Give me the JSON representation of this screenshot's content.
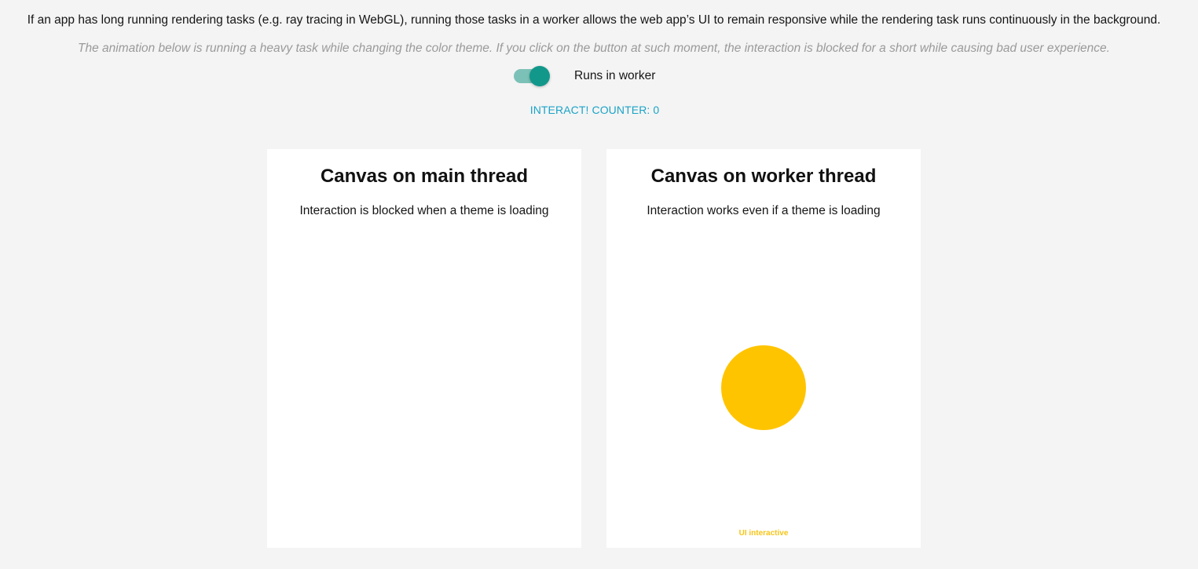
{
  "intro": {
    "text": "If an app has long running rendering tasks (e.g. ray tracing in WebGL), running those tasks in a worker allows the web app’s UI to remain responsive while the rendering task runs continuously in the background.",
    "note": "The animation below is running a heavy task while changing the color theme. If you click on the button at such moment, the interaction is blocked for a short while causing bad user experience."
  },
  "toggle": {
    "label": "Runs in worker",
    "checked": true,
    "color": "#12988b"
  },
  "counter_button": {
    "label": "INTERACT! COUNTER: 0",
    "color": "#1aa3c7"
  },
  "cards": {
    "main": {
      "title": "Canvas on main thread",
      "description": "Interaction is blocked when a theme is loading"
    },
    "worker": {
      "title": "Canvas on worker thread",
      "description": "Interaction works even if a theme is loading",
      "status": "UI interactive",
      "ball_color": "#ffc400"
    }
  }
}
